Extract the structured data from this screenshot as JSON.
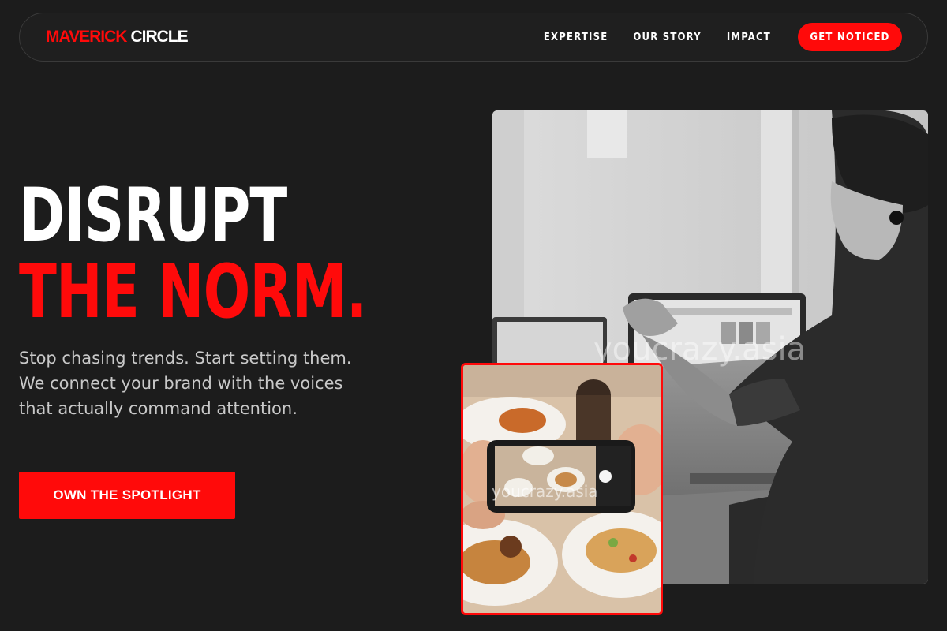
{
  "brand": {
    "part1": "MAVERICK",
    "part2": "CIRCLE"
  },
  "nav": {
    "links": [
      "EXPERTISE",
      "OUR STORY",
      "IMPACT"
    ],
    "cta": "GET NOTICED"
  },
  "hero": {
    "title_line1": "DISRUPT",
    "title_line2": "THE NORM.",
    "subtitle": "Stop chasing trends. Start setting them. We connect your brand with the voices that actually command attention.",
    "cta": "OWN THE SPOTLIGHT"
  },
  "images": {
    "main_watermark": "youcrazy.asia",
    "inset_watermark": "youcrazy.asia"
  },
  "colors": {
    "background": "#1c1c1c",
    "accent": "#ff0a0a",
    "text": "#ffffff",
    "muted_text": "#c9c9c9"
  }
}
